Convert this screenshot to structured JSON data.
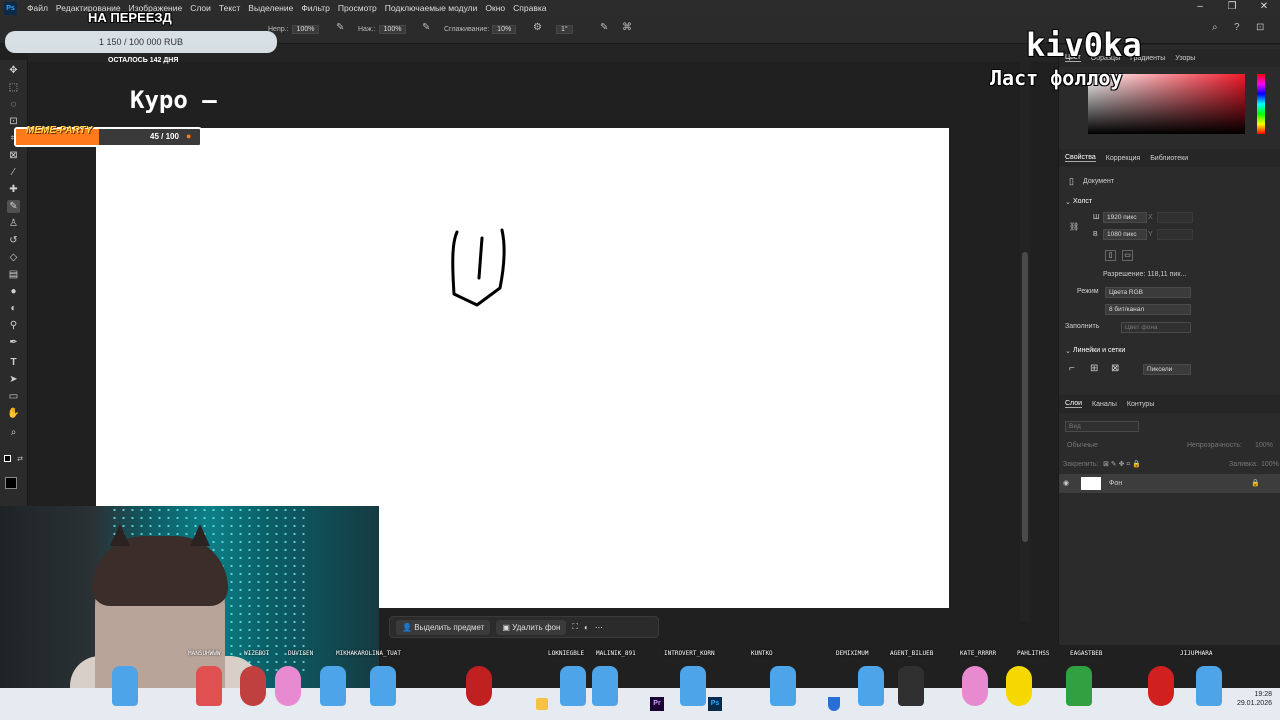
{
  "menubar": {
    "app_icon": "Ps",
    "items": [
      "Файл",
      "Редактирование",
      "Изображение",
      "Слои",
      "Текст",
      "Выделение",
      "Фильтр",
      "Просмотр",
      "Подключаемые модули",
      "Окно",
      "Справка"
    ]
  },
  "options": {
    "opacity_label": "Непр.:",
    "opacity_value": "100%",
    "pressure_label": "Наж.:",
    "pressure_value": "100%",
    "smoothing_label": "Сглаживание:",
    "smoothing_value": "10%",
    "angle_value": "1°"
  },
  "overlay": {
    "goal_amount": "1 150 / 100 000 RUB",
    "goal_title": "НА ПЕРЕЕЗД",
    "days_left": "ОСТАЛОСЬ 142 ДНЯ",
    "stream_text": "Куро  –",
    "meme_title": "MEME-PARTY",
    "meme_progress_text": "45 / 100",
    "meme_progress": 0.45,
    "streamer_name": "kiv0ka",
    "last_follow": "Ласт фоллоу"
  },
  "right_panel": {
    "top_tabs": [
      "Цвет",
      "Образцы",
      "Градиенты",
      "Узоры"
    ],
    "props_tabs": [
      "Свойства",
      "Коррекция",
      "Библиотеки"
    ],
    "document_label": "Документ",
    "canvas_section": "Холст",
    "width_label": "Ш",
    "width_value": "1920 пикс",
    "height_label": "В",
    "height_value": "1080 пикс",
    "x_label": "X",
    "y_label": "Y",
    "resolution": "Разрешение: 118,11 пик...",
    "mode_label": "Режим",
    "mode_value": "Цвета RGB",
    "bits_value": "8 бит/канал",
    "fill_label": "Заполнить",
    "fill_value": "Цвет фона",
    "rulers_section": "Линейки и сетки",
    "units_value": "Пиксели",
    "layer_tabs": [
      "Слои",
      "Каналы",
      "Контуры"
    ],
    "search_placeholder": "Вид",
    "blend_mode": "Обычные",
    "opacity_label": "Непрозрачность:",
    "opacity_value": "100%",
    "lock_label": "Закрепить:",
    "fill2_label": "Заливка:",
    "fill2_value": "100%",
    "layer_name": "Фон"
  },
  "floatbar": {
    "select_subject": "Выделить предмет",
    "remove_bg": "Удалить фон"
  },
  "chat_names": [
    "MANSUHWWW",
    "WIZEBOT",
    "DUVISEN",
    "MIKHAKAROLINA_TUAT",
    "LOKNIEGBLE",
    "MALINIK_891",
    "INTROVERT_KORN",
    "KUNTKO",
    "DEMIXIMUM",
    "AGENT_BILUEB",
    "KATE_RRRRR",
    "PAHLITHSS",
    "EAGASTBEB",
    "JIJUPHARA"
  ],
  "taskbar": {
    "time": "19:28",
    "date": "29.01.2026"
  },
  "colors": {
    "accent": "#31a8ff",
    "panel": "#2b2b2b",
    "canvas": "#ffffff",
    "meme_fill": "#ff7a1a"
  }
}
